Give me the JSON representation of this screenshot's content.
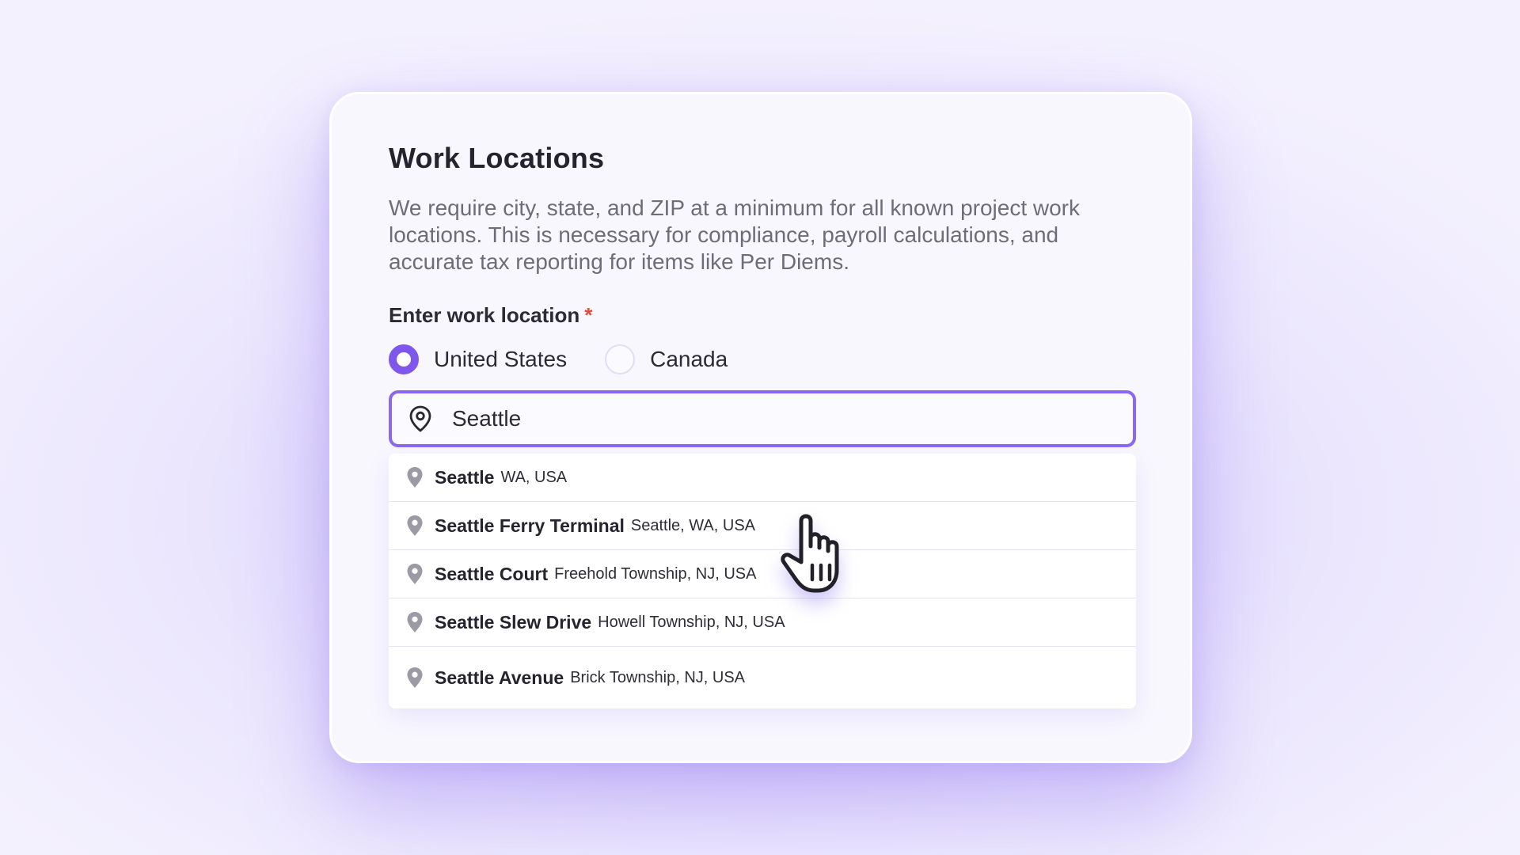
{
  "card": {
    "title": "Work Locations",
    "description": "We require city, state, and ZIP at a minimum for all known project work locations. This is necessary for compliance, payroll calculations, and accurate tax reporting for items like Per Diems.",
    "field_label": "Enter work location",
    "required_marker": "*"
  },
  "country_options": [
    {
      "label": "United States",
      "selected": true
    },
    {
      "label": "Canada",
      "selected": false
    }
  ],
  "search": {
    "value": "Seattle",
    "icon": "map-pin-icon"
  },
  "suggestions": [
    {
      "name": "Seattle",
      "detail": "WA, USA"
    },
    {
      "name": "Seattle Ferry Terminal",
      "detail": "Seattle, WA, USA"
    },
    {
      "name": "Seattle Court",
      "detail": "Freehold Township, NJ, USA"
    },
    {
      "name": "Seattle Slew Drive",
      "detail": "Howell Township, NJ, USA"
    },
    {
      "name": "Seattle Avenue",
      "detail": "Brick Township, NJ, USA"
    }
  ],
  "colors": {
    "accent": "#8057ec",
    "input_border": "#8b68f1",
    "required": "#e2483c",
    "title_text": "#25232d",
    "body_text": "#6e6c77"
  },
  "cursor_icon": "hand-pointer-icon"
}
